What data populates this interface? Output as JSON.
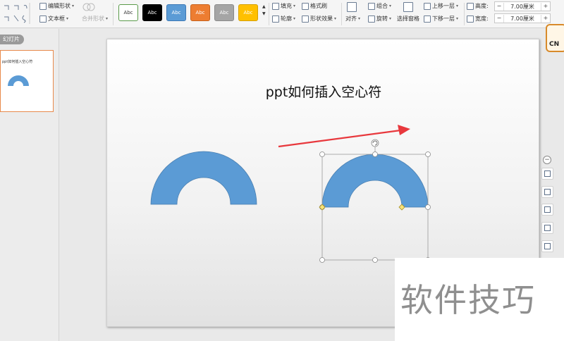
{
  "ribbon": {
    "edit_shape": "编辑形状",
    "text_box": "文本框",
    "merge_shape": "合并形状",
    "style_presets": [
      {
        "label": "Abc",
        "bg": "#ffffff",
        "fg": "#333333",
        "border": "#5a9a4a"
      },
      {
        "label": "Abc",
        "bg": "#000000",
        "fg": "#ffffff",
        "border": "#000000"
      },
      {
        "label": "Abc",
        "bg": "#5b9bd5",
        "fg": "#ffffff",
        "border": "#3d78b5"
      },
      {
        "label": "Abc",
        "bg": "#ed7d31",
        "fg": "#ffffff",
        "border": "#c7621d"
      },
      {
        "label": "Abc",
        "bg": "#a5a5a5",
        "fg": "#ffffff",
        "border": "#8a8a8a"
      },
      {
        "label": "Abc",
        "bg": "#ffc000",
        "fg": "#ffffff",
        "border": "#d6a000"
      }
    ],
    "fill": "填充",
    "format_painter": "格式刷",
    "outline": "轮廓",
    "shape_effects": "形状效果",
    "align": "对齐",
    "group": "组合",
    "rotate": "旋转",
    "selection_pane": "选择窗格",
    "bring_forward": "上移一层",
    "send_backward": "下移一层",
    "height_label": "高度:",
    "height_value": "7.00厘米",
    "width_label": "宽度:",
    "width_value": "7.00厘米",
    "minus": "−",
    "plus": "+"
  },
  "left_panel": {
    "tab_label": "幻灯片",
    "thumb_title": "ppt如何插入空心符"
  },
  "slide": {
    "title": "ppt如何插入空心符"
  },
  "colors": {
    "shape_fill": "#5b9bd5",
    "arrow": "#e8383d",
    "handle_yellow": "#f7e27a"
  },
  "logo_text": "CN",
  "watermark": "软件技巧"
}
